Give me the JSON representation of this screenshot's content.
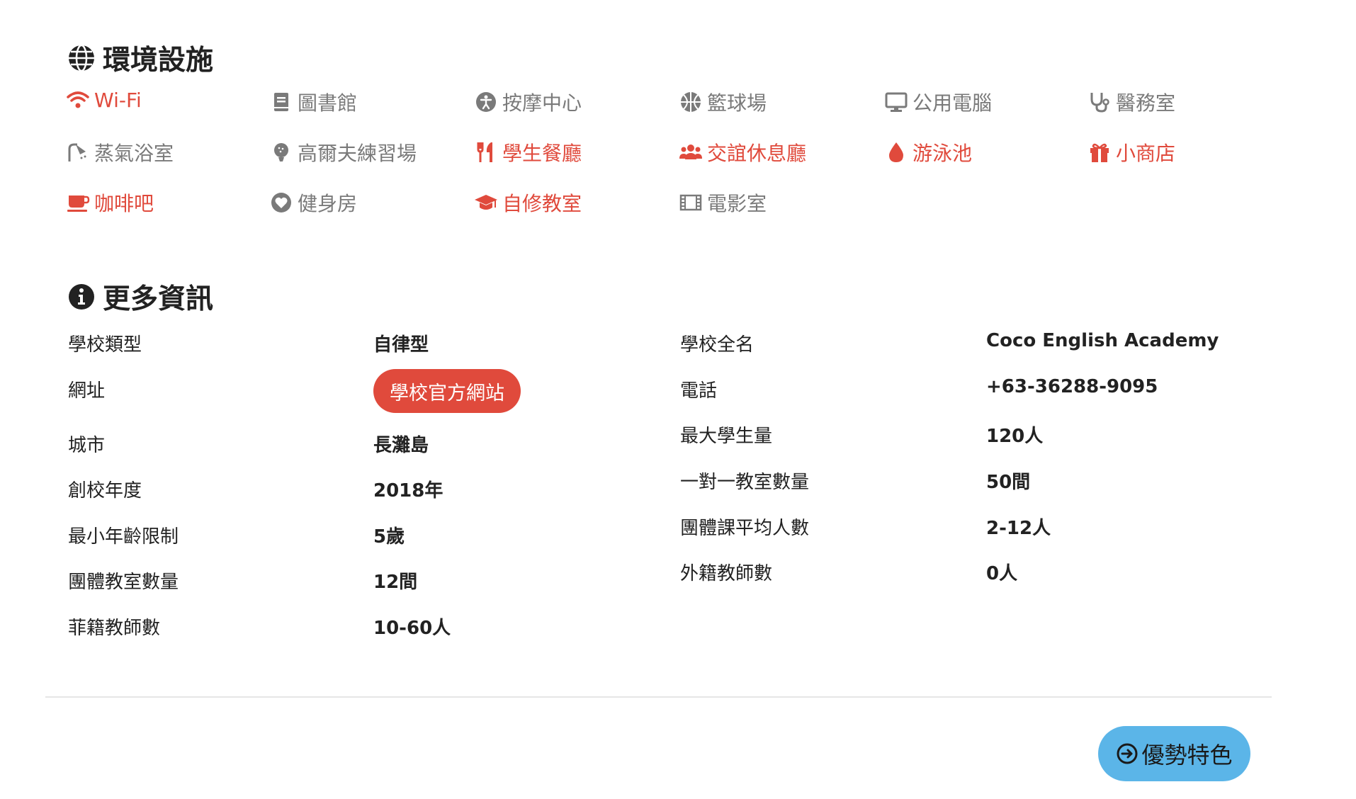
{
  "colors": {
    "active": "#e04a3c",
    "inactive": "#7a7a7a",
    "text": "#222222",
    "button_red": "#e04a3c",
    "button_blue": "#5bb5e8"
  },
  "facilities_section": {
    "title": "環境設施",
    "icon": "globe-icon",
    "items": [
      {
        "label": "Wi-Fi",
        "icon": "wifi-icon",
        "active": true
      },
      {
        "label": "圖書館",
        "icon": "book-icon",
        "active": false
      },
      {
        "label": "按摩中心",
        "icon": "accessibility-icon",
        "active": false
      },
      {
        "label": "籃球場",
        "icon": "basketball-icon",
        "active": false
      },
      {
        "label": "公用電腦",
        "icon": "desktop-icon",
        "active": false
      },
      {
        "label": "醫務室",
        "icon": "stethoscope-icon",
        "active": false
      },
      {
        "label": "蒸氣浴室",
        "icon": "shower-icon",
        "active": false
      },
      {
        "label": "高爾夫練習場",
        "icon": "golf-icon",
        "active": false
      },
      {
        "label": "學生餐廳",
        "icon": "utensils-icon",
        "active": true
      },
      {
        "label": "交誼休息廳",
        "icon": "users-icon",
        "active": true
      },
      {
        "label": "游泳池",
        "icon": "water-drop-icon",
        "active": true
      },
      {
        "label": "小商店",
        "icon": "gift-icon",
        "active": true
      },
      {
        "label": "咖啡吧",
        "icon": "coffee-icon",
        "active": true
      },
      {
        "label": "健身房",
        "icon": "heart-icon",
        "active": false
      },
      {
        "label": "自修教室",
        "icon": "graduation-cap-icon",
        "active": true
      },
      {
        "label": "電影室",
        "icon": "film-icon",
        "active": false
      }
    ]
  },
  "info_section": {
    "title": "更多資訊",
    "icon": "info-icon",
    "left": [
      {
        "label": "學校類型",
        "value": "自律型"
      },
      {
        "label": "網址",
        "value": "學校官方網站"
      },
      {
        "label": "城市",
        "value": "長灘島"
      },
      {
        "label": "創校年度",
        "value": "2018年"
      },
      {
        "label": "最小年齡限制",
        "value": "5歲"
      },
      {
        "label": "團體教室數量",
        "value": "12間"
      },
      {
        "label": "菲籍教師數",
        "value": "10-60人"
      }
    ],
    "right": [
      {
        "label": "學校全名",
        "value": "Coco English Academy"
      },
      {
        "label": "電話",
        "value": "+63-36288-9095"
      },
      {
        "label": "最大學生量",
        "value": "120人"
      },
      {
        "label": "一對一教室數量",
        "value": "50間"
      },
      {
        "label": "團體課平均人數",
        "value": "2-12人"
      },
      {
        "label": "外籍教師數",
        "value": "0人"
      }
    ]
  },
  "footer": {
    "feature_button": "優勢特色",
    "feature_icon": "arrow-circle-right-icon"
  }
}
